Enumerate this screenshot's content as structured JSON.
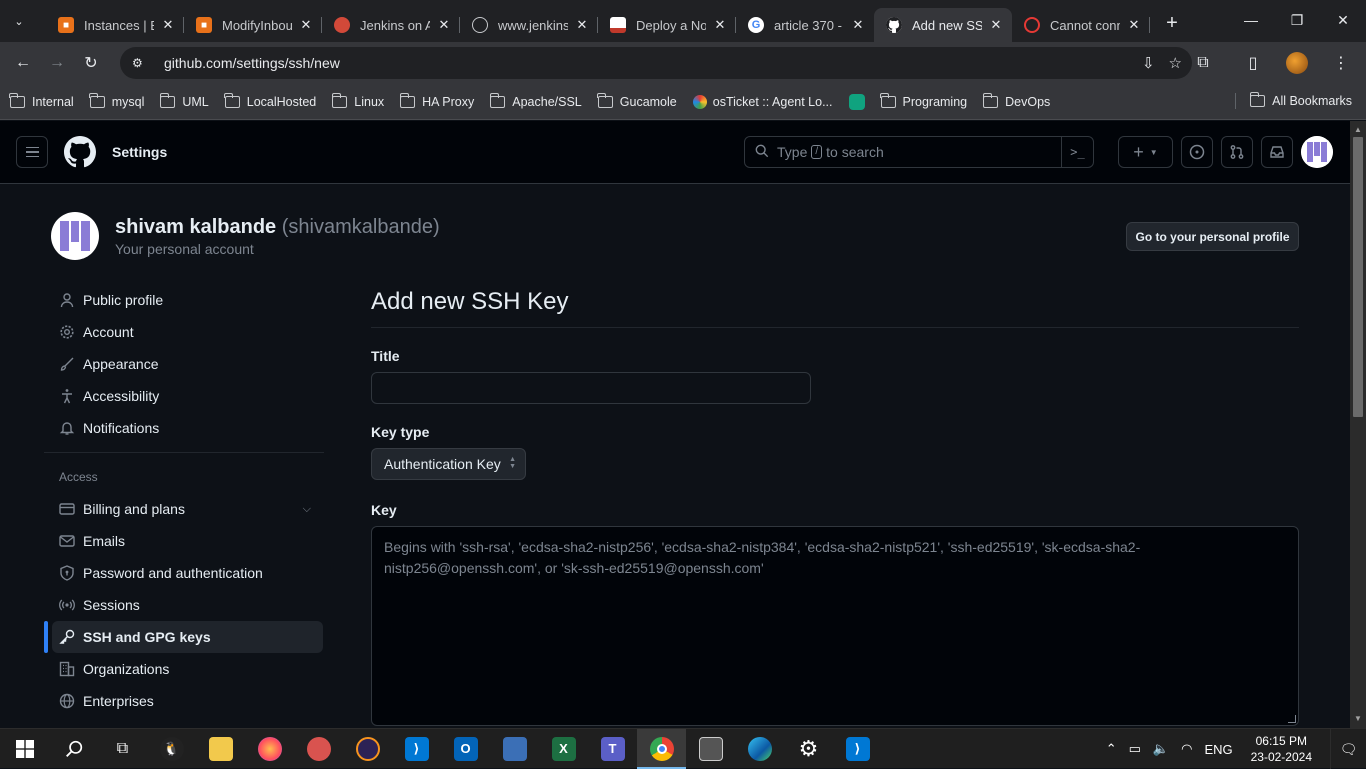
{
  "browser": {
    "tabs": [
      {
        "title": "Instances | EC",
        "favicon_color": "#e8711a",
        "favicon": "AWS"
      },
      {
        "title": "ModifyInbou",
        "favicon_color": "#e8711a",
        "favicon": "AWS"
      },
      {
        "title": "Jenkins on AW",
        "favicon_color": "#d24939",
        "favicon": "jenkins"
      },
      {
        "title": "www.jenkins.",
        "favicon_color": "#5f6368",
        "favicon": "globe"
      },
      {
        "title": "Deploy a No",
        "favicon_color": "#c0392b",
        "favicon": "doc"
      },
      {
        "title": "article 370 -",
        "favicon_color": "#4285f4",
        "favicon": "google"
      },
      {
        "title": "Add new SSH",
        "favicon_color": "#ffffff",
        "favicon": "github",
        "active": true
      },
      {
        "title": "Cannot conn",
        "favicon_color": "#e53935",
        "favicon": "blocked"
      }
    ],
    "url": "github.com/settings/ssh/new",
    "bookmarks": [
      "Internal",
      "mysql",
      "UML",
      "LocalHosted",
      "Linux",
      "HA Proxy",
      "Apache/SSL",
      "Gucamole",
      "osTicket :: Agent Lo...",
      "",
      "Programing",
      "DevOps"
    ],
    "all_bookmarks": "All Bookmarks"
  },
  "header": {
    "title": "Settings",
    "search_prefix": "Type",
    "search_key": "/",
    "search_suffix": "to search"
  },
  "profile": {
    "name": "shivam kalbande",
    "login": "(shivamkalbande)",
    "subtitle": "Your personal account",
    "button": "Go to your personal profile"
  },
  "sidebar": {
    "items": [
      {
        "label": "Public profile",
        "icon": "person-icon"
      },
      {
        "label": "Account",
        "icon": "gear-icon"
      },
      {
        "label": "Appearance",
        "icon": "paintbrush-icon"
      },
      {
        "label": "Accessibility",
        "icon": "accessibility-icon"
      },
      {
        "label": "Notifications",
        "icon": "bell-icon"
      }
    ],
    "access_heading": "Access",
    "access_items": [
      {
        "label": "Billing and plans",
        "icon": "credit-card-icon"
      },
      {
        "label": "Emails",
        "icon": "mail-icon"
      },
      {
        "label": "Password and authentication",
        "icon": "shield-lock-icon"
      },
      {
        "label": "Sessions",
        "icon": "broadcast-icon"
      },
      {
        "label": "SSH and GPG keys",
        "icon": "key-icon",
        "active": true
      },
      {
        "label": "Organizations",
        "icon": "organization-icon"
      },
      {
        "label": "Enterprises",
        "icon": "globe-icon"
      }
    ]
  },
  "form": {
    "heading": "Add new SSH Key",
    "title_label": "Title",
    "title_value": "",
    "key_type_label": "Key type",
    "key_type_value": "Authentication Key",
    "key_label": "Key",
    "key_placeholder": "Begins with 'ssh-rsa', 'ecdsa-sha2-nistp256', 'ecdsa-sha2-nistp384', 'ecdsa-sha2-nistp521', 'ssh-ed25519', 'sk-ecdsa-sha2-nistp256@openssh.com', or 'sk-ssh-ed25519@openssh.com'"
  },
  "taskbar": {
    "language": "ENG",
    "time": "06:15 PM",
    "date": "23-02-2024"
  }
}
